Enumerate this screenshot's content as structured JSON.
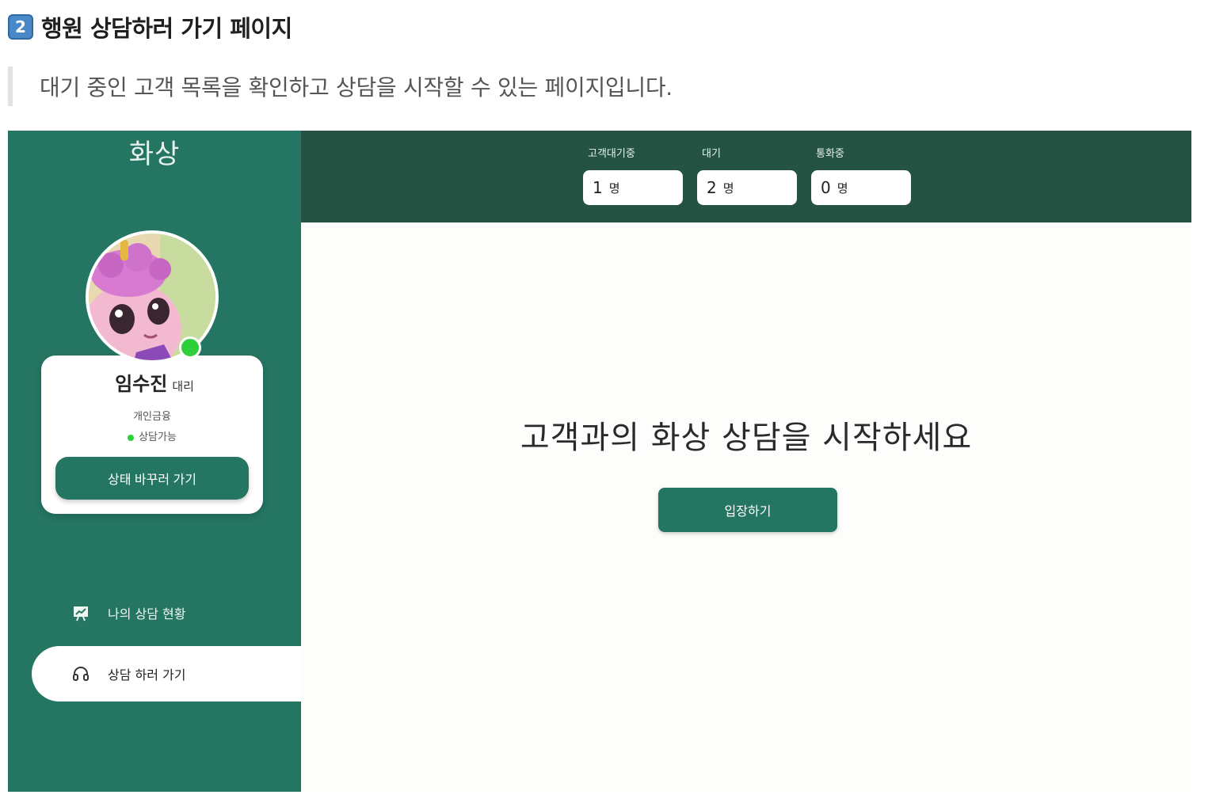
{
  "doc": {
    "section_number": "2",
    "title": "행원 상담하러 가기 페이지",
    "description": "대기 중인 고객 목록을 확인하고 상담을 시작할 수 있는 페이지입니다."
  },
  "app": {
    "logo": "화상",
    "profile": {
      "name": "임수진",
      "rank": "대리",
      "department": "개인금융",
      "status": "상담가능",
      "status_color": "#2fce3b",
      "change_status_label": "상태 바꾸러 가기"
    },
    "nav": [
      {
        "label": "나의 상담 현황",
        "icon": "presentation-board-icon",
        "active": false
      },
      {
        "label": "상담 하러 가기",
        "icon": "headset-icon",
        "active": true
      }
    ],
    "stats": [
      {
        "label": "고객대기중",
        "value": "1",
        "unit": "명"
      },
      {
        "label": "대기",
        "value": "2",
        "unit": "명"
      },
      {
        "label": "통화중",
        "value": "0",
        "unit": "명"
      }
    ],
    "main": {
      "message": "고객과의 화상 상담을 시작하세요",
      "enter_label": "입장하기"
    },
    "colors": {
      "sidebar": "#247561",
      "topbar": "#245344",
      "accent": "#247561"
    }
  }
}
